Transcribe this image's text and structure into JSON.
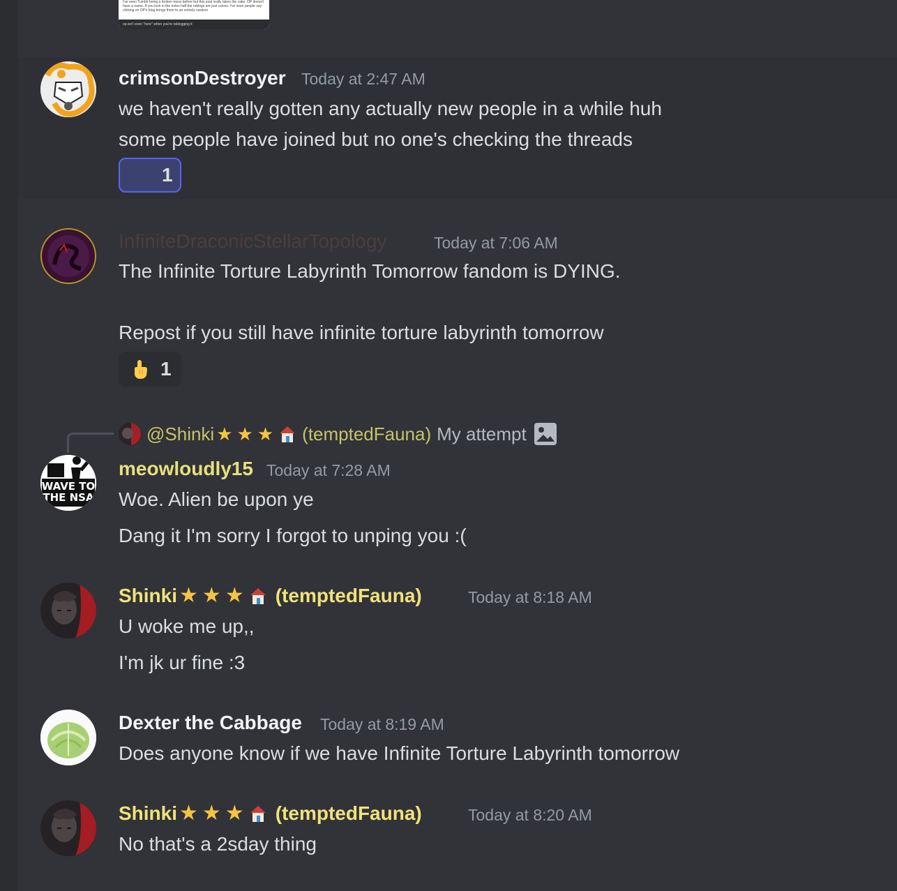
{
  "embed_preview": {
    "text_lines": "I've seen Tumblr being a broken mess before but this post really takes the cake. OP doesn't have a name. If you look in the notes half the reblogs are just colons. I've seen people say clicking on OP's blog brings them to an entirely random",
    "caption": "op isn't even \"here\" when you're reblogging it"
  },
  "messages": [
    {
      "username": "crimsonDestroyer",
      "username_color": "#f2f3f5",
      "timestamp": "Today at 2:47 AM",
      "lines": [
        "we haven't really gotten any actually new people in a while huh",
        "some people have joined but no one's checking the threads"
      ],
      "reaction": {
        "emoji": "crescent-moon",
        "count": "1",
        "active": true
      }
    },
    {
      "username": "InfiniteDraconicStellarTopology",
      "username_color": "#4d3d3d",
      "timestamp": "Today at 7:06 AM",
      "lines": [
        "The Infinite Torture Labyrinth Tomorrow fandom is DYING.",
        "Repost if you still have infinite torture labyrinth tomorrow"
      ],
      "reaction": {
        "emoji": "pointing-hand",
        "count": "1",
        "active": false
      }
    },
    {
      "reply": {
        "name": "@Shinki",
        "suffix": "(temptedFauna)",
        "text": "My attempt"
      },
      "username": "meowloudly15",
      "username_color": "#e7e07e",
      "timestamp": "Today at 7:28 AM",
      "lines": [
        "Woe. Alien be upon ye",
        "Dang it I'm sorry I forgot to unping you :("
      ]
    },
    {
      "username": "Shinki",
      "username_suffix": "(temptedFauna)",
      "username_color": "#f1e27a",
      "timestamp": "Today at 8:18 AM",
      "lines": [
        "U woke me up,,",
        "I'm jk ur fine :3"
      ]
    },
    {
      "username": "Dexter the Cabbage",
      "username_color": "#f2f3f5",
      "timestamp": "Today at 8:19 AM",
      "lines": [
        "Does anyone know if we have Infinite Torture Labyrinth tomorrow"
      ]
    },
    {
      "username": "Shinki",
      "username_suffix": "(temptedFauna)",
      "username_color": "#f1e27a",
      "timestamp": "Today at 8:20 AM",
      "lines": [
        "No that's a 2sday thing"
      ]
    }
  ],
  "avatar_text": {
    "nsa_line1": "WAVE TO",
    "nsa_line2": "THE NSA"
  }
}
